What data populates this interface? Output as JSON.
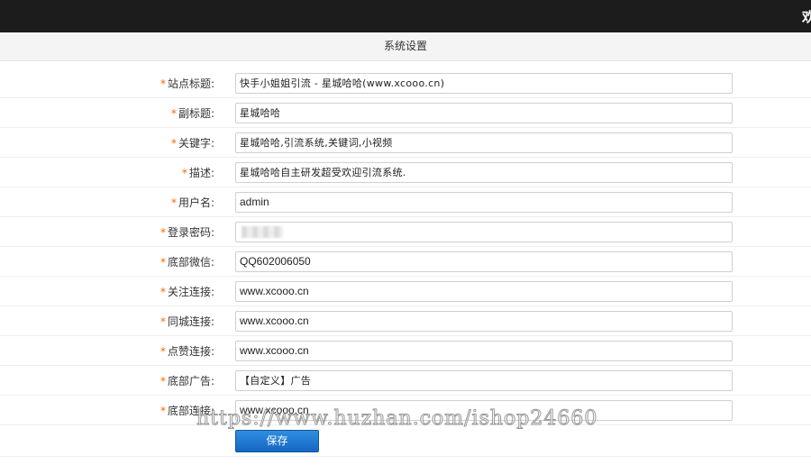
{
  "header": {
    "welcome_text": "欢迎"
  },
  "panel": {
    "title": "系统设置"
  },
  "form": {
    "required_mark": "*",
    "rows": [
      {
        "label": "站点标题:",
        "value": "快手小姐姐引流 - 星城哈哈(www.xcooo.cn)"
      },
      {
        "label": "副标题:",
        "value": "星城哈哈"
      },
      {
        "label": "关键字:",
        "value": "星城哈哈,引流系统,关键词,小视频"
      },
      {
        "label": "描述:",
        "value": "星城哈哈自主研发超受欢迎引流系统."
      },
      {
        "label": "用户名:",
        "value": "admin"
      },
      {
        "label": "登录密码:",
        "value": ""
      },
      {
        "label": "底部微信:",
        "value": "QQ602006050"
      },
      {
        "label": "关注连接:",
        "value": "www.xcooo.cn"
      },
      {
        "label": "同城连接:",
        "value": "www.xcooo.cn"
      },
      {
        "label": "点赞连接:",
        "value": "www.xcooo.cn"
      },
      {
        "label": "底部广告:",
        "value": "【自定义】广告"
      },
      {
        "label": "底部连接:",
        "value": "www.xcooo.cn"
      }
    ],
    "save_label": "保存"
  },
  "watermark": {
    "text": "https://www.huzhan.com/ishop24660"
  }
}
